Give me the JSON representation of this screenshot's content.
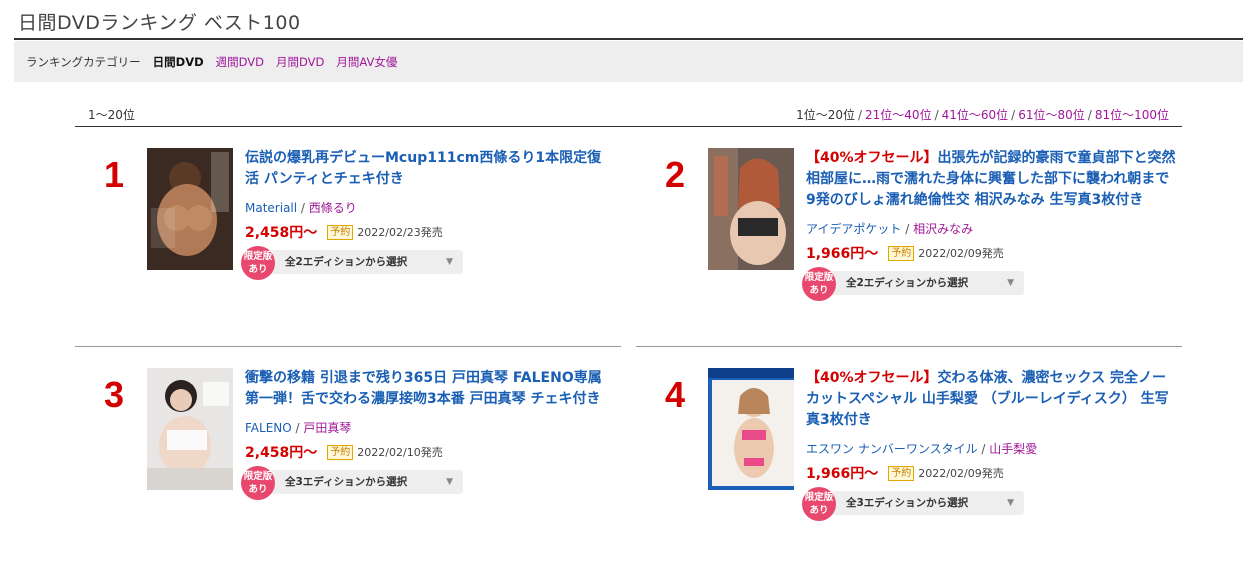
{
  "page": {
    "title": "日間DVDランキング ベスト100"
  },
  "category_bar": {
    "label": "ランキングカテゴリー",
    "current": "日間DVD",
    "links": [
      "週間DVD",
      "月間DVD",
      "月間AV女優"
    ]
  },
  "range": {
    "current": "1〜20位",
    "active_label": "1位〜20位",
    "links": [
      "21位〜40位",
      "41位〜60位",
      "61位〜80位",
      "81位〜100位"
    ],
    "separator": "/"
  },
  "items": [
    {
      "rank": "1",
      "sale": "",
      "title": "伝説の爆乳再デビューMcup111cm西條るり1本限定復活 パンティとチェキ付き",
      "maker": "Materiall",
      "actress": "西條るり",
      "price": "2,458円〜",
      "badge": "予約",
      "date": "2022/02/23発売",
      "edition_badge": "限定版あり",
      "edition_label": "全2エディションから選択"
    },
    {
      "rank": "2",
      "sale": "【40%オフセール】",
      "title": "出張先が記録的豪雨で童貞部下と突然相部屋に…雨で濡れた身体に興奮した部下に襲われ朝まで9発のびしょ濡れ絶倫性交 相沢みなみ 生写真3枚付き",
      "maker": "アイデアポケット",
      "actress": "相沢みなみ",
      "price": "1,966円〜",
      "badge": "予約",
      "date": "2022/02/09発売",
      "edition_badge": "限定版あり",
      "edition_label": "全2エディションから選択"
    },
    {
      "rank": "3",
      "sale": "",
      "title": "衝撃の移籍 引退まで残り365日 戸田真琴 FALENO専属第一弾！舌で交わる濃厚接吻3本番 戸田真琴 チェキ付き",
      "maker": "FALENO",
      "actress": "戸田真琴",
      "price": "2,458円〜",
      "badge": "予約",
      "date": "2022/02/10発売",
      "edition_badge": "限定版あり",
      "edition_label": "全3エディションから選択"
    },
    {
      "rank": "4",
      "sale": "【40%オフセール】",
      "title": "交わる体液、濃密セックス 完全ノーカットスペシャル 山手梨愛 （ブルーレイディスク） 生写真3枚付き",
      "maker": "エスワン ナンバーワンスタイル",
      "actress": "山手梨愛",
      "price": "1,966円〜",
      "badge": "予約",
      "date": "2022/02/09発売",
      "edition_badge": "限定版あり",
      "edition_label": "全3エディションから選択"
    }
  ],
  "icons": {
    "dropdown": "chevron-down-icon",
    "thumbnail": "product-cover-image"
  },
  "colors": {
    "accent_red": "#d40000",
    "link_blue": "#1a5fb4",
    "link_purple": "#a0179a",
    "badge_pink": "#e8486d"
  }
}
